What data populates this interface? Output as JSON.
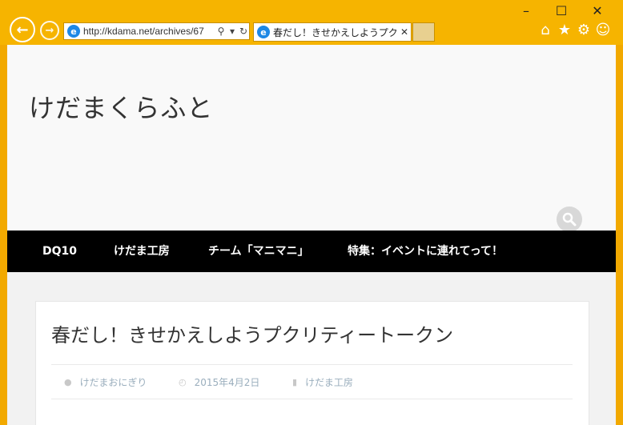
{
  "browser": {
    "url": "http://kdama.net/archives/67",
    "tab_title": "春だし！きせかえしようプクリティ...",
    "icons": {
      "back": "back-arrow-icon",
      "forward": "forward-arrow-icon",
      "search": "search-icon",
      "dropdown": "chevron-down-icon",
      "refresh": "refresh-icon",
      "close_tab": "close-icon",
      "home": "home-icon",
      "favorites": "star-icon",
      "settings": "gear-icon",
      "feedback": "smiley-icon"
    },
    "accent_color": "#f6b400"
  },
  "site": {
    "title": "けだまくらふと",
    "nav": [
      {
        "label": "DQ10"
      },
      {
        "label": "けだま工房"
      },
      {
        "label": "チーム「マニマニ」"
      },
      {
        "label": "特集：イベントに連れてって！"
      }
    ]
  },
  "article": {
    "title": "春だし！きせかえしようプクリティートークン",
    "author": "けだまおにぎり",
    "date": "2015年4月2日",
    "category": "けだま工房"
  }
}
